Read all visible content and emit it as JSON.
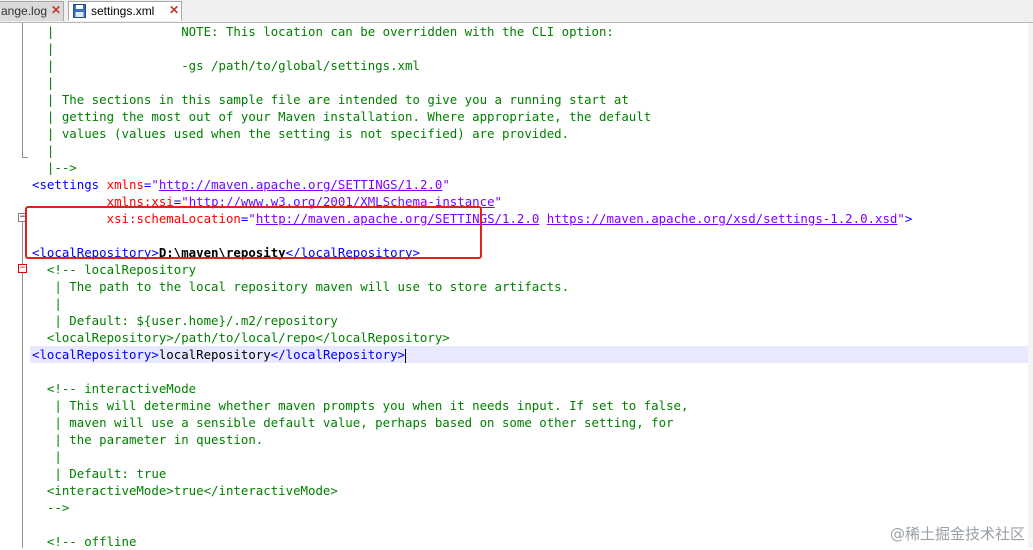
{
  "tabs": [
    {
      "label": "ange.log",
      "active": false
    },
    {
      "label": "settings.xml",
      "active": true
    }
  ],
  "editor": {
    "lines": {
      "l1": "  |                 NOTE: This location can be overridden with the CLI option:",
      "l2": "  |",
      "l3": "  |                 -gs /path/to/global/settings.xml",
      "l4": "  |",
      "l5": "  | The sections in this sample file are intended to give you a running start at",
      "l6": "  | getting the most out of your Maven installation. Where appropriate, the default",
      "l7": "  | values (values used when the setting is not specified) are provided.",
      "l8": "  |",
      "l9": "  |-->",
      "settings_open": "<settings",
      "xmlns_attr": "xmlns",
      "xmlns_val": "http://maven.apache.org/SETTINGS/1.2.0",
      "xsi_attr": "xmlns:xsi",
      "xsi_val": "http://www.w3.org/2001/XMLSchema-instance",
      "schema_attr": "xsi:schemaLocation",
      "schema_val1": "http://maven.apache.org/SETTINGS/1.2.0",
      "schema_val2": "https://maven.apache.org/xsd/settings-1.2.0.xsd",
      "settings_close": ">",
      "local_repo_open": "<localRepository>",
      "local_repo_value": "D:\\maven\\reposity",
      "local_repo_close": "</localRepository>",
      "c1": "  <!-- localRepository",
      "c2": "   | The path to the local repository maven will use to store artifacts.",
      "c3": "   |",
      "c4": "   | Default: ${user.home}/.m2/repository",
      "c5": "  <localRepository>/path/to/local/repo</localRepository>",
      "current_open": "<localRepository>",
      "current_value": "localRepository",
      "current_close": "</localRepository>",
      "i1": "  <!-- interactiveMode",
      "i2": "   | This will determine whether maven prompts you when it needs input. If set to false,",
      "i3": "   | maven will use a sensible default value, perhaps based on some other setting, for",
      "i4": "   | the parameter in question.",
      "i5": "   |",
      "i6": "   | Default: true",
      "i7": "  <interactiveMode>true</interactiveMode>",
      "i8": "  -->",
      "o1": "  <!-- offline"
    }
  },
  "watermark": "@稀土掘金技术社区",
  "colors": {
    "comment": "#008000",
    "tag": "#0000ff",
    "attr_name": "#ff0000",
    "attr_value": "#8000ff",
    "highlight_box": "#e32020",
    "current_line": "#e8e8ff"
  },
  "icons": {
    "active_tab": "save-disk-icon",
    "tab_close": "close-icon",
    "fold": "fold-minus-icon"
  }
}
